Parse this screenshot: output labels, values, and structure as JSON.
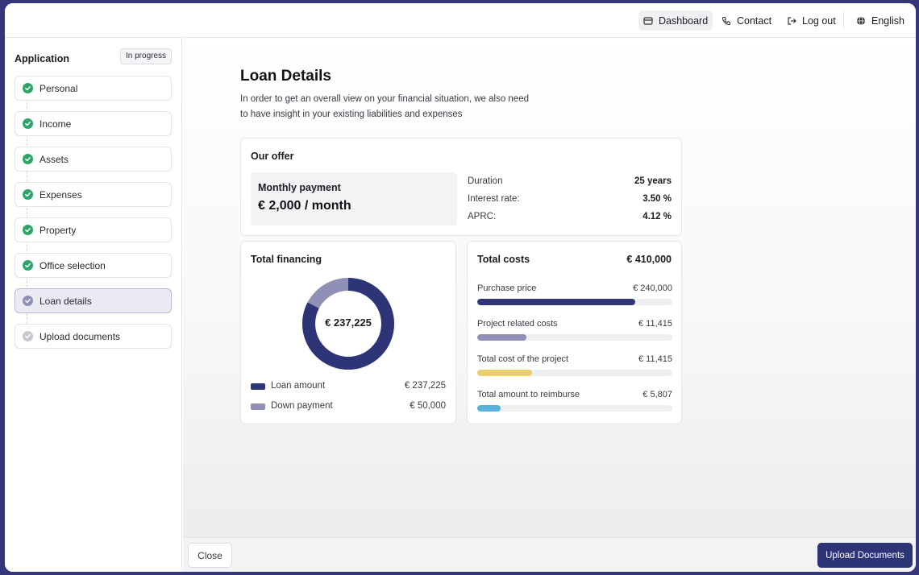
{
  "topbar": {
    "items": [
      {
        "label": "Dashboard",
        "icon": "dashboard-icon"
      },
      {
        "label": "Contact",
        "icon": "phone-icon"
      },
      {
        "label": "Log out",
        "icon": "logout-icon"
      },
      {
        "label": "English",
        "icon": "globe-icon"
      }
    ]
  },
  "sidebar": {
    "title": "Application",
    "status_badge": "In progress",
    "steps": [
      {
        "label": "Personal",
        "state": "done"
      },
      {
        "label": "Income",
        "state": "done"
      },
      {
        "label": "Assets",
        "state": "done"
      },
      {
        "label": "Expenses",
        "state": "done"
      },
      {
        "label": "Property",
        "state": "done"
      },
      {
        "label": "Office selection",
        "state": "done"
      },
      {
        "label": "Loan details",
        "state": "current"
      },
      {
        "label": "Upload documents",
        "state": "pending"
      }
    ]
  },
  "main": {
    "title": "Loan Details",
    "description": "In order to get an overall view on your financial situation, we also need to have insight in your existing liabilities and expenses",
    "offer": {
      "title": "Our offer",
      "monthly_label": "Monthly payment",
      "monthly_value": "€ 2,000 / month",
      "details": [
        {
          "label": "Duration",
          "value": "25 years"
        },
        {
          "label": "Interest rate:",
          "value": "3.50 %"
        },
        {
          "label": "APRC:",
          "value": "4.12 %"
        }
      ]
    },
    "financing": {
      "title": "Total financing",
      "center_value": "€ 237,225",
      "legend": [
        {
          "label": "Loan amount",
          "value": "€ 237,225",
          "color": "#2e3577",
          "amount": 237225
        },
        {
          "label": "Down payment",
          "value": "€ 50,000",
          "color": "#8f90b5",
          "amount": 50000
        }
      ]
    },
    "costs": {
      "title": "Total costs",
      "total": "€ 410,000",
      "rows": [
        {
          "label": "Purchase price",
          "value": "€ 240,000",
          "fraction": 0.81,
          "color": "#2e3577"
        },
        {
          "label": "Project related costs",
          "value": "€ 11,415",
          "fraction": 0.25,
          "color": "#8f90b5"
        },
        {
          "label": "Total cost of the project",
          "value": "€ 11,415",
          "fraction": 0.28,
          "color": "#e9cf6a"
        },
        {
          "label": "Total amount to reimburse",
          "value": "€ 5,807",
          "fraction": 0.12,
          "color": "#5ab1dc"
        }
      ]
    }
  },
  "footer": {
    "close_label": "Close",
    "upload_label": "Upload Documents"
  },
  "colors": {
    "accent": "#2e3577",
    "success": "#2ea36a",
    "pending": "#c8c8ce",
    "current": "#8f90b5"
  }
}
